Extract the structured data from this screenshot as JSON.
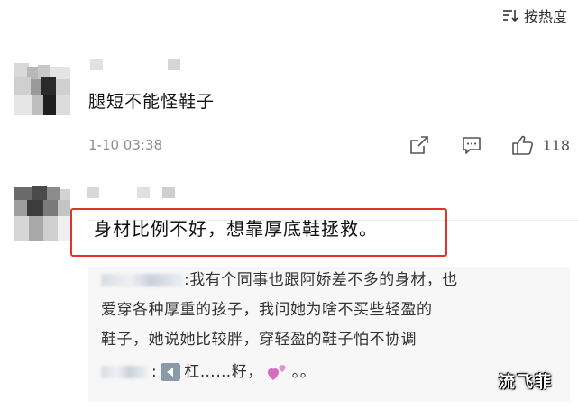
{
  "sort": {
    "label": "按热度",
    "icon": "sort-icon"
  },
  "comments": [
    {
      "text": "腿短不能怪鞋子",
      "time": "1-10 03:38",
      "likes": "118",
      "icons": [
        "share-icon",
        "comment-icon",
        "thumbs-up-icon"
      ]
    },
    {
      "text": "身材比例不好，想靠厚底鞋拯救。",
      "highlight_color": "#e0342b",
      "reply": {
        "line1": ":我有个同事也跟阿娇差不多的身材，也",
        "line2": "爱穿各种厚重的孩子，我问她为啥不买些轻盈的",
        "line3": "鞋子，她说她比较胖，穿轻盈的鞋子怕不协调",
        "line4_colon": ":",
        "line4_text": "杠……籽，",
        "line4_tail": "。。",
        "icons": [
          "sound-icon",
          "two-hearts-icon"
        ]
      }
    }
  ],
  "watermark": "流飞菲"
}
